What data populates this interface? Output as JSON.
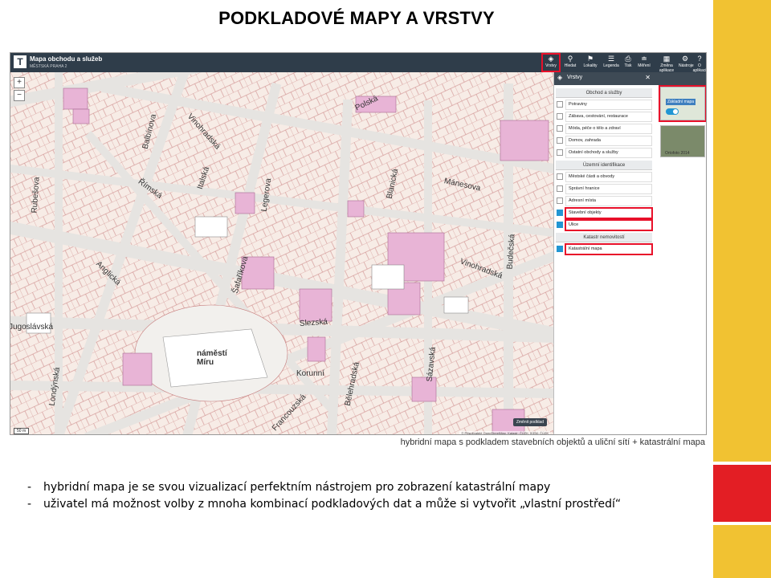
{
  "slide": {
    "title": "PODKLADOVÉ MAPY A VRSTVY",
    "caption": "hybridní mapa s podkladem stavebních objektů a uliční sítí + katastrální mapa",
    "bullets": [
      "hybridní mapa je se svou vizualizací perfektním nástrojem pro zobrazení katastrální mapy",
      "uživatel má možnost volby z mnoha kombinací podkladových dat a může si vytvořit „vlastní prostředí“"
    ],
    "colors": {
      "accent_yellow": "#f1c232",
      "accent_red": "#e31e24",
      "highlight": "#e8102a"
    }
  },
  "app": {
    "title": "Mapa obchodu a služeb",
    "subtitle": "MĚSTSKÁ PRAHA 2",
    "toolbar": [
      {
        "label": "Vrstvy",
        "icon": "layers-icon",
        "active": true
      },
      {
        "label": "Hledat",
        "icon": "search-icon"
      },
      {
        "label": "Lokality",
        "icon": "location-icon"
      },
      {
        "label": "Legenda",
        "icon": "legend-icon"
      },
      {
        "label": "Tisk",
        "icon": "print-icon"
      },
      {
        "label": "Měření",
        "icon": "measure-icon"
      },
      {
        "label": "Změna aplikace",
        "icon": "grid-icon"
      },
      {
        "label": "Nástroje",
        "icon": "tools-icon"
      },
      {
        "label": "O aplikaci",
        "icon": "info-icon"
      }
    ],
    "map": {
      "streets": [
        "Polská",
        "Vinohradská",
        "Římská",
        "Italská",
        "Mánesova",
        "Blanická",
        "Budečská",
        "Slezská",
        "Korunní",
        "Londýnská",
        "Jugoslávská",
        "Anglická",
        "Rubešova",
        "Balbínova",
        "Legerova",
        "Sázavská",
        "Francouzská",
        "Bělehradská",
        "Šafaříkova",
        "Vinohradská"
      ],
      "place": "náměstí Míru",
      "attribution": "© Přispěvatelé OpenStreetMap, Katastr: ČÚZK, IKEM: ČÚZK",
      "scale": "50 m",
      "basemap_button": "Změnit podklad"
    },
    "panel": {
      "title": "Vrstvy",
      "groups": [
        {
          "label": "Obchod a služby",
          "items": [
            {
              "label": "Potraviny",
              "on": false
            },
            {
              "label": "Zábava, cestování, restaurace",
              "on": false
            },
            {
              "label": "Móda, péče o tělo a zdraví",
              "on": false
            },
            {
              "label": "Domov, zahrada",
              "on": false
            },
            {
              "label": "Ostatní obchody a služby",
              "on": false
            }
          ]
        },
        {
          "label": "Územní identifikace",
          "items": [
            {
              "label": "Městské části a obvody",
              "on": false
            },
            {
              "label": "Správní hranice",
              "on": false
            },
            {
              "label": "Adresní místa",
              "on": false
            },
            {
              "label": "Stavební objekty",
              "on": true
            },
            {
              "label": "Ulice",
              "on": true
            }
          ]
        },
        {
          "label": "Katastr nemovitostí",
          "items": [
            {
              "label": "Katastrální mapa",
              "on": true
            }
          ]
        }
      ],
      "basemaps": [
        {
          "label": "Základní mapa"
        },
        {
          "label": "Ortofoto 2014"
        }
      ]
    }
  }
}
